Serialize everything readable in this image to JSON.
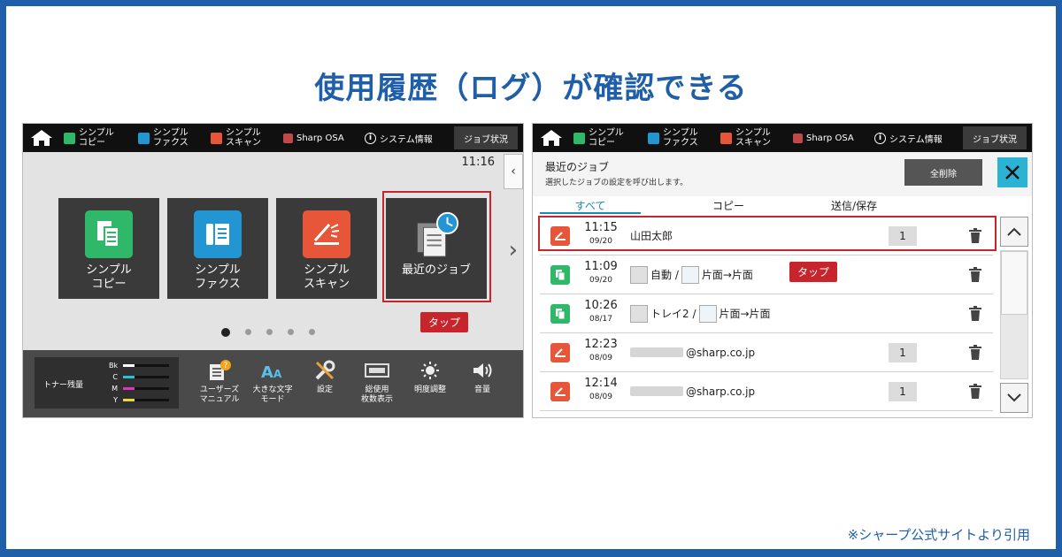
{
  "headline": "使用履歴（ログ）が確認できる",
  "source_note": "※シャープ公式サイトより引用",
  "topbar": {
    "items": [
      {
        "line1": "シンプル",
        "line2": "コピー",
        "color": "#2fb86a"
      },
      {
        "line1": "シンプル",
        "line2": "ファクス",
        "color": "#2196d3"
      },
      {
        "line1": "シンプル",
        "line2": "スキャン",
        "color": "#e8563a"
      }
    ],
    "osa_label": "Sharp OSA",
    "system_info_label": "システム情報",
    "job_status_label": "ジョブ状況"
  },
  "left_panel": {
    "clock": "11:16",
    "tiles": [
      {
        "line1": "シンプル",
        "line2": "コピー",
        "color": "#2fb86a"
      },
      {
        "line1": "シンプル",
        "line2": "ファクス",
        "color": "#2196d3"
      },
      {
        "line1": "シンプル",
        "line2": "スキャン",
        "color": "#e8563a"
      },
      {
        "line1": "最近のジョブ",
        "line2": "",
        "color": "#4a4a4a"
      }
    ],
    "tap_label": "タップ",
    "page_dots": 5,
    "active_dot": 0,
    "toner": {
      "label": "トナー残量",
      "levels": [
        {
          "letter": "Bk",
          "color": "#ffffff",
          "level": 0.25
        },
        {
          "letter": "C",
          "color": "#27c3d8",
          "level": 0.25
        },
        {
          "letter": "M",
          "color": "#e033c4",
          "level": 0.25
        },
        {
          "letter": "Y",
          "color": "#e8d838",
          "level": 0.25
        }
      ]
    },
    "tools": [
      {
        "line1": "ユーザーズ",
        "line2": "マニュアル",
        "icon": "manual-icon"
      },
      {
        "line1": "大きな文字",
        "line2": "モード",
        "icon": "large-text-icon"
      },
      {
        "line1": "設定",
        "line2": "",
        "icon": "settings-icon"
      },
      {
        "line1": "総使用",
        "line2": "枚数表示",
        "icon": "counter-icon"
      },
      {
        "line1": "明度調整",
        "line2": "",
        "icon": "brightness-icon"
      },
      {
        "line1": "音量",
        "line2": "",
        "icon": "volume-icon"
      }
    ]
  },
  "right_panel": {
    "title": "最近のジョブ",
    "subtitle": "選択したジョブの設定を呼び出します。",
    "delete_all_label": "全削除",
    "tabs": [
      "すべて",
      "コピー",
      "送信/保存"
    ],
    "active_tab": 0,
    "tap_label": "タップ",
    "jobs": [
      {
        "type": "scan",
        "time": "11:15",
        "date": "09/20",
        "detail_text": "山田太郎",
        "count": "1"
      },
      {
        "type": "copy",
        "time": "11:09",
        "date": "09/20",
        "detail_a": "自動 /",
        "detail_b": "片面→片面",
        "count": ""
      },
      {
        "type": "copy",
        "time": "10:26",
        "date": "08/17",
        "detail_a": "トレイ2 /",
        "detail_b": "片面→片面",
        "count": ""
      },
      {
        "type": "scan",
        "time": "12:23",
        "date": "08/09",
        "detail_text": "@sharp.co.jp",
        "count": "1"
      },
      {
        "type": "scan",
        "time": "12:14",
        "date": "08/09",
        "detail_text": "@sharp.co.jp",
        "count": "1"
      }
    ]
  },
  "colors": {
    "brand_blue": "#1f5ea8",
    "highlight_red": "#c8242b",
    "close_cyan": "#2bb3d6"
  }
}
